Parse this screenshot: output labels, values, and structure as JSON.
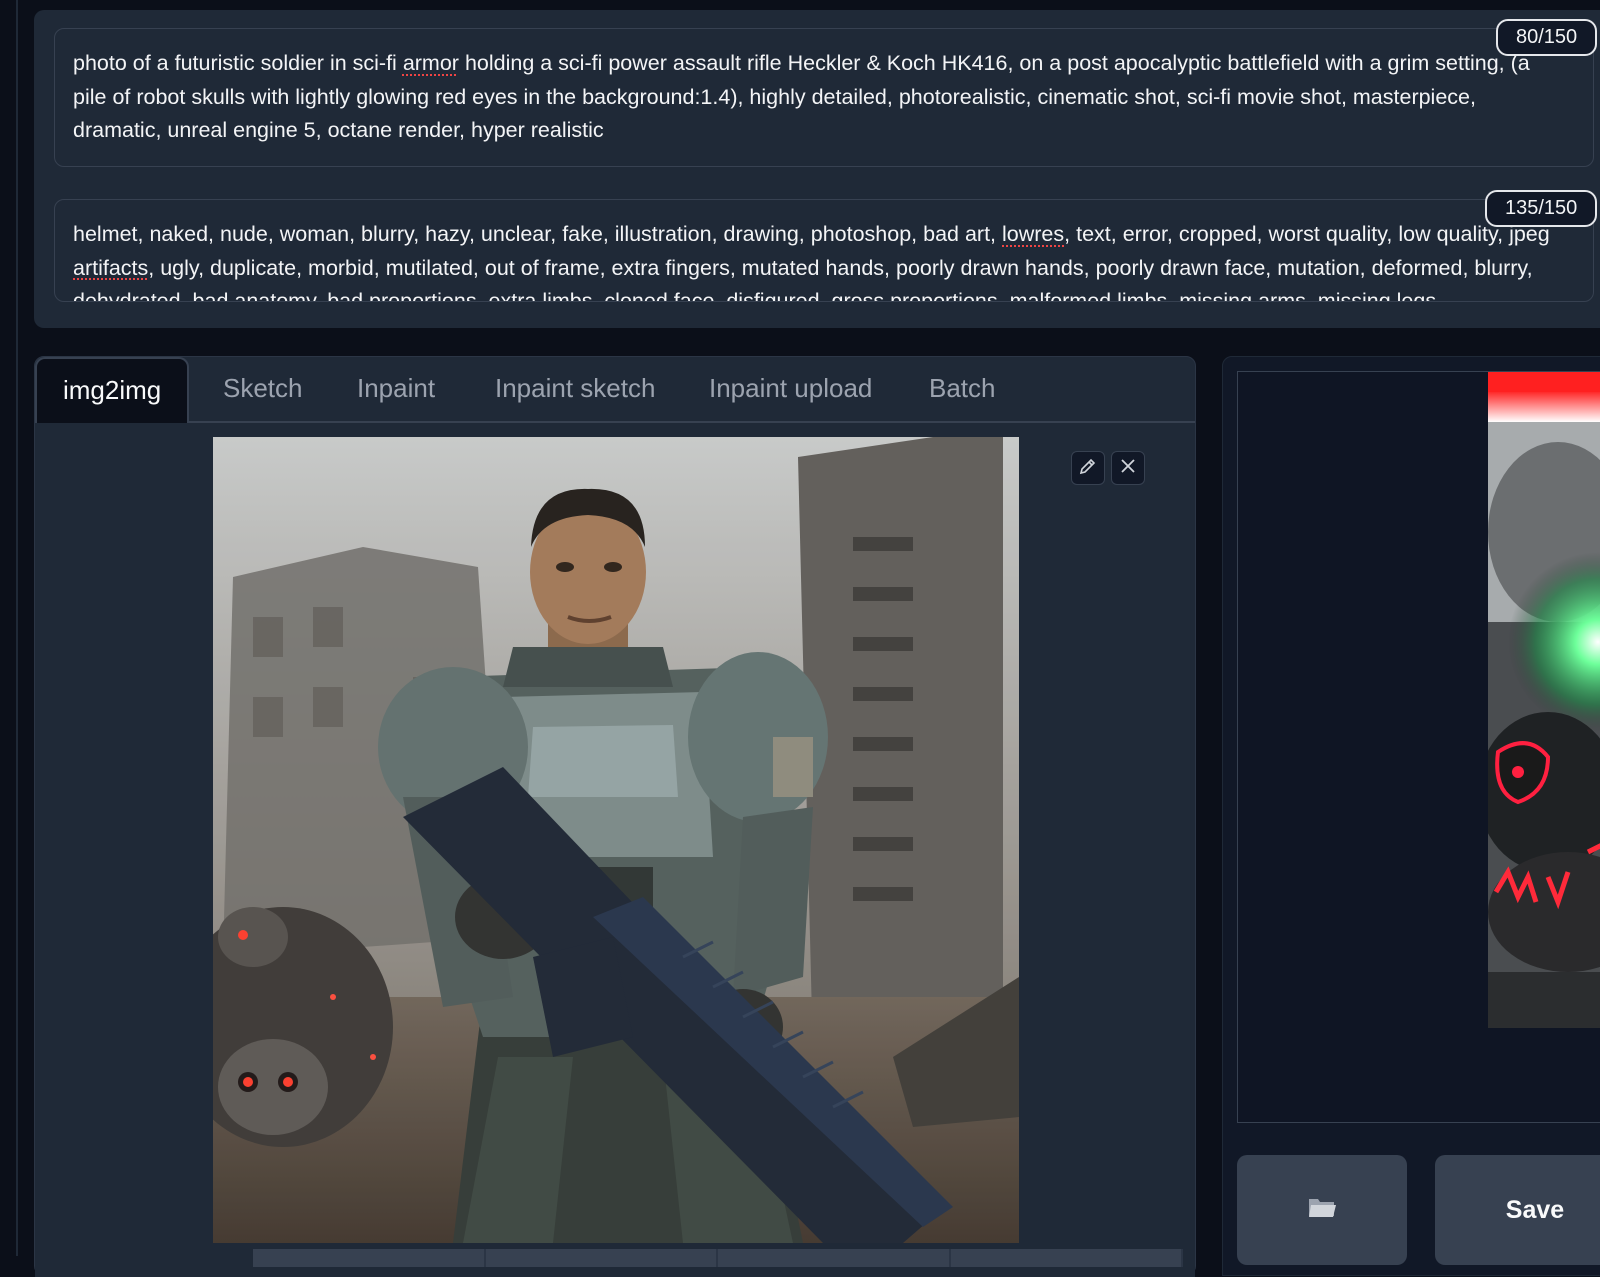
{
  "prompt": {
    "positive_counter": "80/150",
    "positive_parts": [
      "photo of a futuristic soldier in sci-fi ",
      "armor",
      " holding a sci-fi power assault rifle Heckler & Koch HK416, on a post apocalyptic battlefield with a grim setting, (a pile of robot skulls with lightly glowing red eyes in the background:1.4), highly detailed, photorealistic, cinematic shot, sci-fi movie shot, masterpiece, dramatic, unreal engine 5, octane render, hyper realistic"
    ],
    "negative_counter": "135/150",
    "negative_parts": [
      "helmet, naked, nude, woman, blurry, hazy, unclear, fake, illustration, drawing, photoshop, bad art, ",
      "lowres",
      ", text, error, cropped, worst quality, low quality, jpeg ",
      "artifacts",
      ", ugly, duplicate, morbid, mutilated, out of frame, extra fingers, mutated hands, poorly drawn hands, poorly drawn face, mutation, deformed, blurry, dehydrated, bad anatomy, bad proportions, extra limbs, cloned face, disfigured, gross proportions, malformed limbs, missing arms, missing legs"
    ]
  },
  "tabs": [
    "img2img",
    "Sketch",
    "Inpaint",
    "Inpaint sketch",
    "Inpaint upload",
    "Batch"
  ],
  "active_tab": "img2img",
  "image_tools": {
    "edit_icon": "pencil-icon",
    "clear_icon": "close-icon"
  },
  "output": {
    "folder_button_icon": "folder-icon",
    "save_label": "Save"
  },
  "colors": {
    "background": "#0b0f19",
    "panel": "#1f2937",
    "border": "#374151",
    "spellcheck": "#ef4444"
  }
}
